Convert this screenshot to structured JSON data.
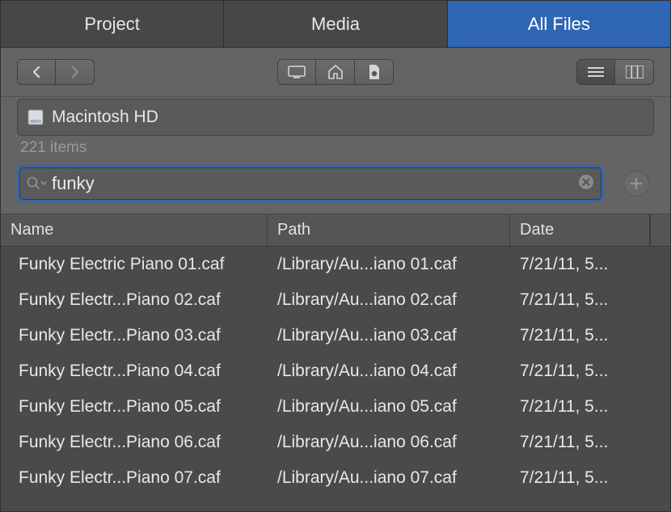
{
  "tabs": {
    "project": "Project",
    "media": "Media",
    "all_files": "All Files",
    "active": "all_files"
  },
  "location": {
    "volume": "Macintosh HD",
    "item_count": "221 items"
  },
  "search": {
    "value": "funky",
    "placeholder": ""
  },
  "columns": {
    "name": "Name",
    "path": "Path",
    "date": "Date"
  },
  "rows": [
    {
      "name": "Funky Electric Piano 01.caf",
      "path": "/Library/Au...iano 01.caf",
      "date": "7/21/11, 5..."
    },
    {
      "name": "Funky Electr...Piano 02.caf",
      "path": "/Library/Au...iano 02.caf",
      "date": "7/21/11, 5..."
    },
    {
      "name": "Funky Electr...Piano 03.caf",
      "path": "/Library/Au...iano 03.caf",
      "date": "7/21/11, 5..."
    },
    {
      "name": "Funky Electr...Piano 04.caf",
      "path": "/Library/Au...iano 04.caf",
      "date": "7/21/11, 5..."
    },
    {
      "name": "Funky Electr...Piano 05.caf",
      "path": "/Library/Au...iano 05.caf",
      "date": "7/21/11, 5..."
    },
    {
      "name": "Funky Electr...Piano 06.caf",
      "path": "/Library/Au...iano 06.caf",
      "date": "7/21/11, 5..."
    },
    {
      "name": "Funky Electr...Piano 07.caf",
      "path": "/Library/Au...iano 07.caf",
      "date": "7/21/11, 5..."
    }
  ]
}
